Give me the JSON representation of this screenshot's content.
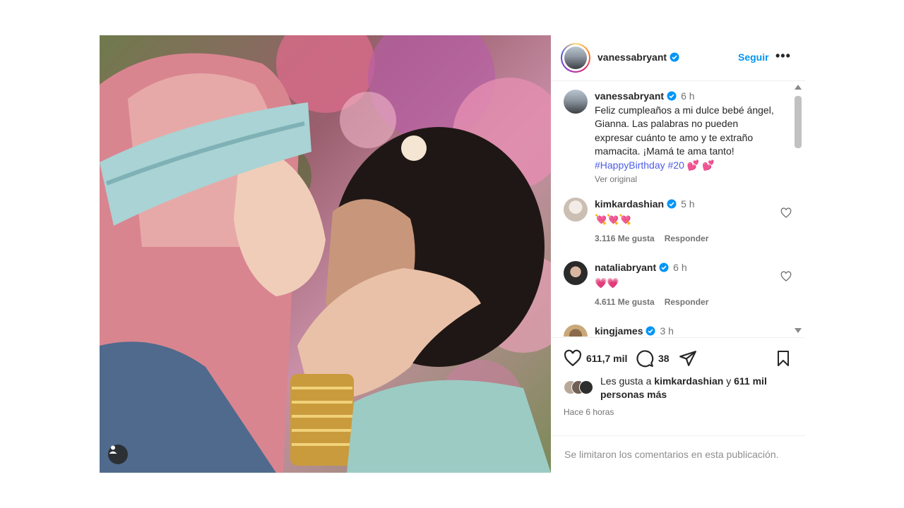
{
  "post": {
    "author": "vanessabryant",
    "follow_label": "Seguir",
    "more_label": "•••",
    "caption": {
      "user": "vanessabryant",
      "time": "6 h",
      "text": "Feliz cumpleaños a mi dulce bebé ángel, Gianna. Las palabras no pueden expresar cuánto te amo y te extraño mamacita. ¡Mamá te ama tanto!",
      "hashtags": "#HappyBirthday #20",
      "emoji": "💕 💕",
      "see_original": "Ver original"
    },
    "comments": [
      {
        "user": "kimkardashian",
        "time": "5 h",
        "text": "💘💘💘",
        "likes": "3.116 Me gusta",
        "reply": "Responder",
        "avatar_color": "#d8cfc6"
      },
      {
        "user": "nataliabryant",
        "time": "6 h",
        "text": "💗💗",
        "likes": "4.611 Me gusta",
        "reply": "Responder",
        "avatar_color": "#3c3c3c"
      },
      {
        "user": "kingjames",
        "time": "3 h",
        "text": "",
        "likes": "",
        "reply": "",
        "avatar_color": "#6b5a45"
      }
    ],
    "actions": {
      "likes_count": "611,7 mil",
      "comments_count": "38"
    },
    "liked_by": {
      "prefix": "Les gusta a ",
      "user": "kimkardashian",
      "middle": " y ",
      "rest": "611 mil personas más"
    },
    "posted_ago": "Hace 6 horas",
    "comments_limited": "Se limitaron los comentarios en esta publicación."
  },
  "colors": {
    "accent": "#0095f6",
    "verified": "#0095f6",
    "hashtag": "#4c5de8",
    "muted": "#737373"
  },
  "icons": [
    "user-tag-icon",
    "verified-badge-icon",
    "more-icon",
    "heart-icon",
    "comment-icon",
    "share-icon",
    "bookmark-icon",
    "scroll-up-icon",
    "scroll-down-icon"
  ]
}
